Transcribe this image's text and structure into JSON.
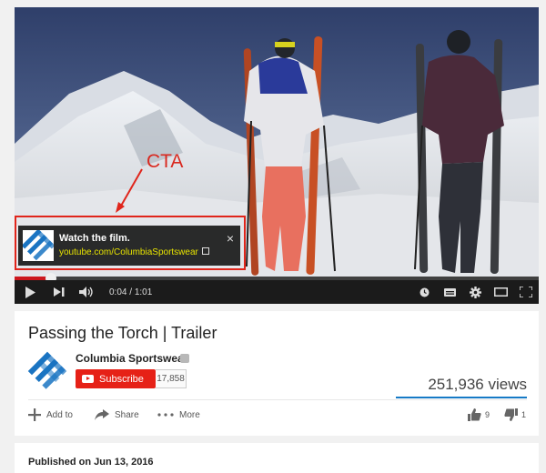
{
  "player": {
    "annotation_label": "CTA",
    "card": {
      "title": "Watch the film.",
      "link": "youtube.com/ColumbiaSportswear",
      "close_glyph": "×"
    },
    "progress_fraction": 0.07,
    "time": {
      "current": "0:04",
      "separator": " / ",
      "duration": "1:01"
    },
    "icons": [
      "play-icon",
      "next-icon",
      "volume-icon",
      "watch-later-icon",
      "captions-icon",
      "settings-gear-icon",
      "theater-mode-icon",
      "fullscreen-icon"
    ],
    "colors": {
      "progress": "#cc181e",
      "card_link": "#e8e400",
      "annotation": "#e0251b"
    }
  },
  "video": {
    "title": "Passing the Torch | Trailer",
    "channel_name": "Columbia Sportswear",
    "subscribe_label": "Subscribe",
    "subscriber_count": "17,858",
    "view_count": "251,936 views",
    "actions": {
      "add_to": "Add to",
      "share": "Share",
      "more": "More"
    },
    "likes": "9",
    "dislikes": "1",
    "colors": {
      "subscribe": "#e62117",
      "sentiment": "#167ac6"
    }
  },
  "description": {
    "published": "Published on Jun 13, 2016"
  }
}
